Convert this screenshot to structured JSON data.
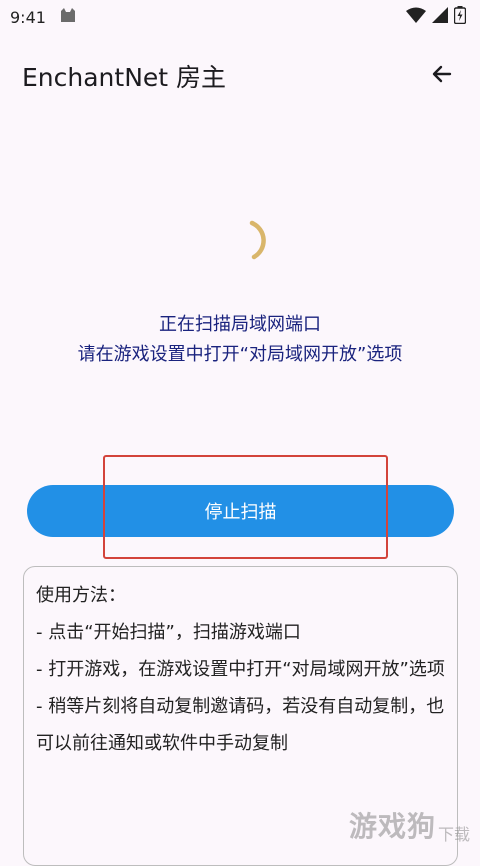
{
  "status_bar": {
    "time": "9:41"
  },
  "app_bar": {
    "title": "EnchantNet 房主"
  },
  "scan": {
    "line1": "正在扫描局域网端口",
    "line2": "请在游戏设置中打开“对局域网开放”选项"
  },
  "stop_button": {
    "label": "停止扫描"
  },
  "usage": {
    "heading": "使用方法：",
    "steps": [
      "- 点击“开始扫描”，扫描游戏端口",
      "- 打开游戏，在游戏设置中打开“对局域网开放”选项",
      "- 稍等片刻将自动复制邀请码，若没有自动复制，也可以前往通知或软件中手动复制"
    ]
  },
  "watermark": {
    "brand": "游戏狗",
    "sub": "下载"
  },
  "colors": {
    "accent": "#2290E6",
    "message": "#1A237E",
    "spinner": "#D9B66B",
    "highlight": "#D3443B"
  }
}
